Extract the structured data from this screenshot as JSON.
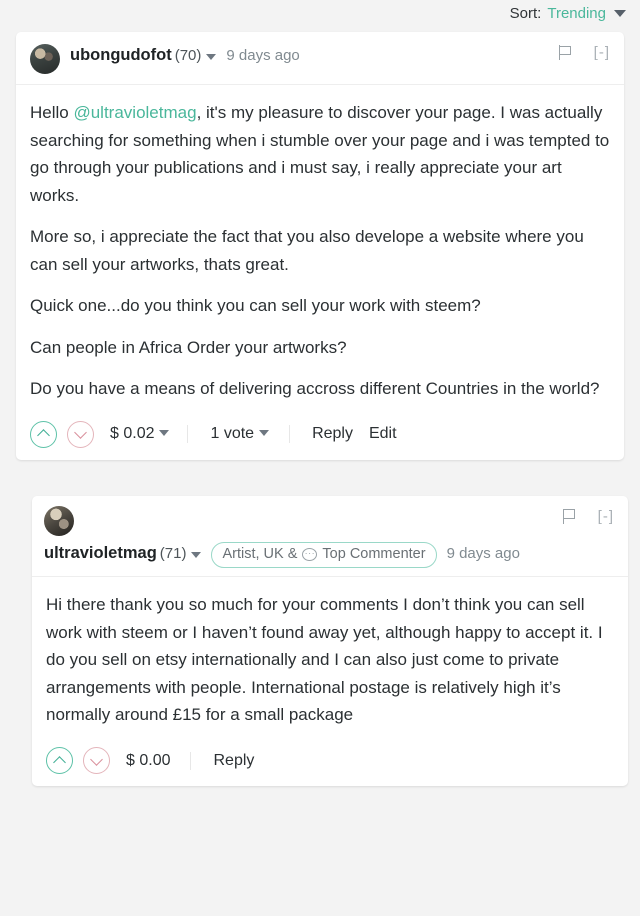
{
  "sort": {
    "label": "Sort:",
    "value": "Trending",
    "caret_icon": "chevron-down-icon"
  },
  "comments": [
    {
      "author": "ubongudofot",
      "reputation": "(70)",
      "timestamp": "9 days ago",
      "flag_icon": "flag-icon",
      "collapse_label": "[-]",
      "paragraphs": [
        {
          "mention": "@ultravioletmag",
          "before": "Hello ",
          "after": ", it's my pleasure to discover your page. I was actually searching for something when i stumble over your page and i was tempted to go through your publications and i must say, i really appreciate your art works."
        },
        {
          "text": "More so, i appreciate the fact that you also develope a website where you can sell your artworks, thats great."
        },
        {
          "text": "Quick one...do you think you can sell your work with steem?"
        },
        {
          "text": "Can people in Africa Order your artworks?"
        },
        {
          "text": "Do you have a means of delivering accross different Countries in the world?"
        }
      ],
      "footer": {
        "upvote_icon": "chevron-up-icon",
        "downvote_icon": "chevron-down-icon",
        "payout": "$ 0.02",
        "votes": "1 vote",
        "reply_label": "Reply",
        "edit_label": "Edit"
      }
    },
    {
      "author": "ultravioletmag",
      "reputation": "(71)",
      "timestamp": "9 days ago",
      "flag_icon": "flag-icon",
      "collapse_label": "[-]",
      "badge": {
        "prefix": "Artist, UK &",
        "icon": "chat-bubble-icon",
        "icon_glyph": "···",
        "suffix": "Top Commenter"
      },
      "paragraphs": [
        {
          "text": "Hi there thank you so much for your comments I don’t think you can sell work with steem or I haven’t found away yet, although happy to accept it. I do you sell on etsy internationally and I can also just come to private arrangements with people. International postage is relatively high it’s normally around £15 for a small package"
        }
      ],
      "footer": {
        "upvote_icon": "chevron-up-icon",
        "downvote_icon": "chevron-down-icon",
        "payout": "$ 0.00",
        "reply_label": "Reply"
      }
    }
  ],
  "colors": {
    "accent_teal": "#4ab79b",
    "downvote_pink": "#e4b5bb",
    "page_background": "#f3f3f3",
    "card_background": "#ffffff"
  }
}
